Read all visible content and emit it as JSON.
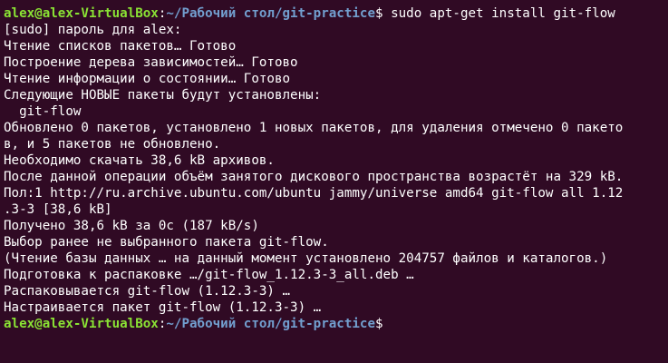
{
  "prompt1": {
    "user_host": "alex@alex-VirtualBox",
    "separator": ":",
    "path": "~/Рабочий стол/git-practice",
    "symbol": "$",
    "command": " sudo apt-get install git-flow"
  },
  "output_lines": [
    "[sudo] пароль для alex:",
    "Чтение списков пакетов… Готово",
    "Построение дерева зависимостей… Готово",
    "Чтение информации о состоянии… Готово",
    "Следующие НОВЫЕ пакеты будут установлены:",
    "  git-flow",
    "Обновлено 0 пакетов, установлено 1 новых пакетов, для удаления отмечено 0 пакето",
    "в, и 5 пакетов не обновлено.",
    "Необходимо скачать 38,6 kB архивов.",
    "После данной операции объём занятого дискового пространства возрастёт на 329 kB.",
    "Пол:1 http://ru.archive.ubuntu.com/ubuntu jammy/universe amd64 git-flow all 1.12",
    ".3-3 [38,6 kB]",
    "Получено 38,6 kB за 0с (187 kB/s)",
    "Выбор ранее не выбранного пакета git-flow.",
    "(Чтение базы данных … на данный момент установлено 204757 файлов и каталогов.)",
    "Подготовка к распаковке …/git-flow_1.12.3-3_all.deb …",
    "Распаковывается git-flow (1.12.3-3) …",
    "Настраивается пакет git-flow (1.12.3-3) …"
  ],
  "prompt2": {
    "user_host": "alex@alex-VirtualBox",
    "separator": ":",
    "path": "~/Рабочий стол/git-practice",
    "symbol": "$"
  },
  "colors": {
    "background": "#300a24",
    "user_host": "#8ae234",
    "path": "#729fcf",
    "text": "#ffffff"
  }
}
